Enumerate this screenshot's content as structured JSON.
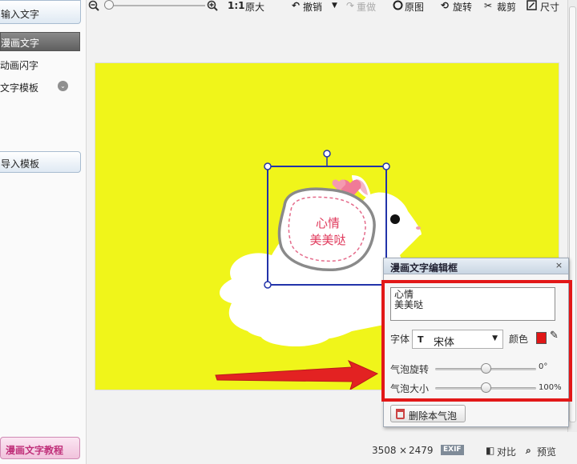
{
  "sidebar": {
    "input_text_button": "输入文字",
    "tabs": [
      {
        "label": "漫画文字"
      },
      {
        "label": "动画闪字"
      },
      {
        "label": "文字模板"
      }
    ],
    "import_template_button": "导入模板",
    "tutorial_button": "漫画文字教程"
  },
  "toolbar": {
    "ratio_label": "1:1",
    "original_size": "原大",
    "undo": "撤销",
    "redo": "重做",
    "original_image": "原图",
    "rotate": "旋转",
    "crop": "裁剪",
    "size": "尺寸"
  },
  "canvas": {
    "background_color": "#f0f51a",
    "bubble_text_line1": "心情",
    "bubble_text_line2": "美美哒"
  },
  "editor": {
    "title": "漫画文字编辑框",
    "close": "×",
    "text_value": "心情\n美美哒",
    "font_label": "字体",
    "font_value": "宋体",
    "color_label": "颜色",
    "color_value": "#e01616",
    "rotate_label": "气泡旋转",
    "rotate_value": "0°",
    "rotate_fraction": 0.5,
    "size_label": "气泡大小",
    "size_value": "100%",
    "size_fraction": 0.5,
    "delete_button": "删除本气泡"
  },
  "status": {
    "width": "3508",
    "times": "×",
    "height": "2479",
    "exif": "EXIF",
    "compare": "对比",
    "preview": "预览"
  }
}
